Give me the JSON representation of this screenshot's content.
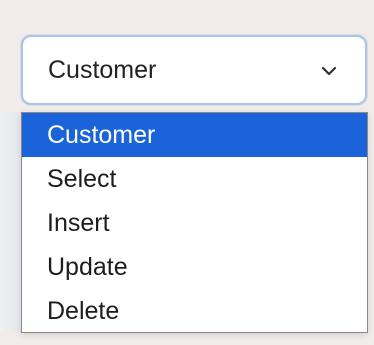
{
  "select": {
    "value": "Customer",
    "icon": "chevron-down-icon"
  },
  "dropdown": {
    "options": [
      {
        "label": "Customer",
        "selected": true
      },
      {
        "label": "Select",
        "selected": false
      },
      {
        "label": "Insert",
        "selected": false
      },
      {
        "label": "Update",
        "selected": false
      },
      {
        "label": "Delete",
        "selected": false
      }
    ]
  },
  "colors": {
    "background": "#f1ece9",
    "focus_border": "#a9c4e6",
    "selected_option": "#1a63d8",
    "dropdown_border": "#8a8a8a"
  }
}
